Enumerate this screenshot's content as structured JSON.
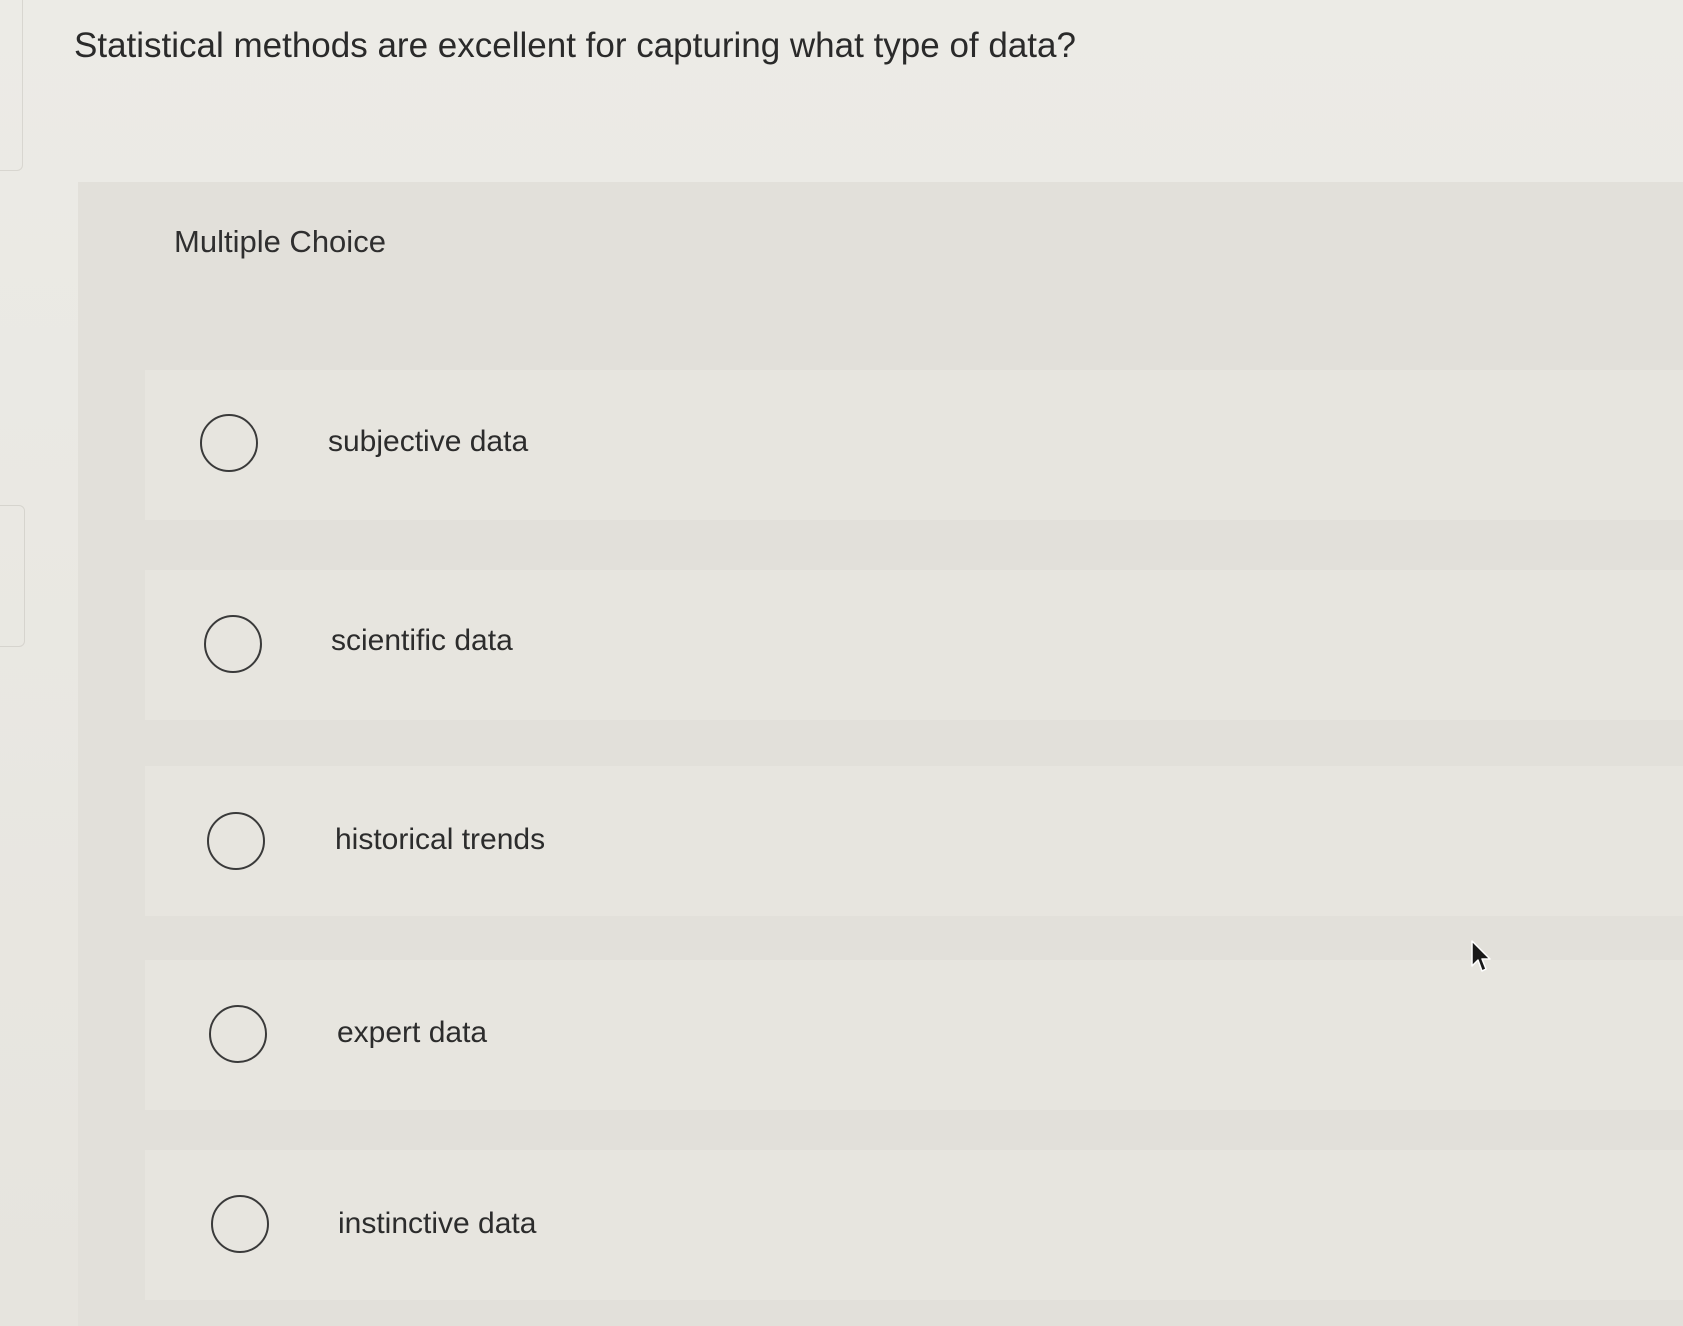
{
  "question": {
    "text": "Statistical methods are excellent for capturing what type of data?"
  },
  "section": {
    "label": "Multiple Choice"
  },
  "options": [
    {
      "label": "subjective data"
    },
    {
      "label": "scientific data"
    },
    {
      "label": "historical trends"
    },
    {
      "label": "expert data"
    },
    {
      "label": "instinctive data"
    }
  ],
  "colors": {
    "background": "#e9e7e2",
    "panel": "#e2e0da",
    "text": "#2b2b2b",
    "radio_border": "#3a3a3a"
  },
  "icons": {
    "radio": "radio-unselected-icon",
    "cursor": "mouse-pointer-icon"
  }
}
